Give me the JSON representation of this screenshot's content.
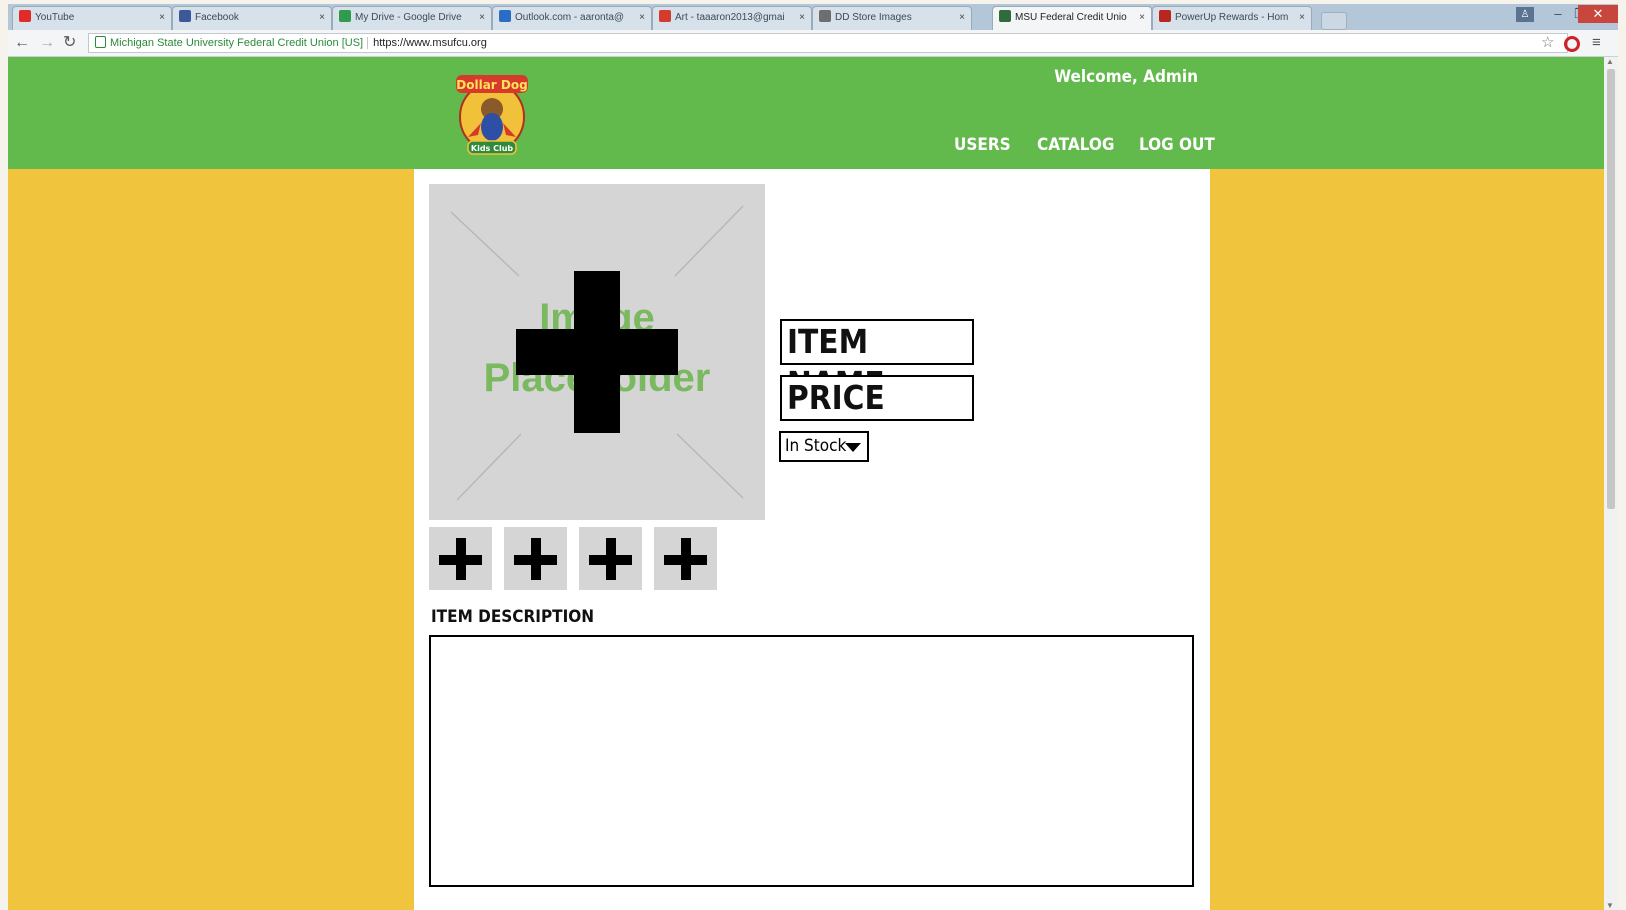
{
  "browser": {
    "tabs": [
      {
        "title": "YouTube",
        "favicon": "youtube-favicon",
        "color": "#e32a2a"
      },
      {
        "title": "Facebook",
        "favicon": "facebook-favicon",
        "color": "#3b5998"
      },
      {
        "title": "My Drive - Google Drive",
        "favicon": "google-drive-favicon",
        "color": "#2e9b4f"
      },
      {
        "title": "Outlook.com - aaronta@",
        "favicon": "outlook-favicon",
        "color": "#2b6cc4"
      },
      {
        "title": "Art - taaaron2013@gmai",
        "favicon": "gmail-favicon",
        "color": "#d33b2c"
      },
      {
        "title": "DD Store Images",
        "favicon": "folder-favicon",
        "color": "#6e6e6e"
      },
      {
        "title": "MSU Federal Credit Unio",
        "favicon": "msu-favicon",
        "color": "#2f6b3b",
        "active": true
      },
      {
        "title": "PowerUp Rewards - Hom",
        "favicon": "gamestop-favicon",
        "color": "#b8261f"
      }
    ],
    "tab_close_glyph": "×",
    "address": {
      "site_name": "Michigan State University Federal Credit Union [US]",
      "url": "https://www.msufcu.org"
    }
  },
  "header": {
    "welcome": "Welcome, Admin",
    "nav": [
      {
        "label": "USERS"
      },
      {
        "label": "CATALOG"
      },
      {
        "label": "LOG OUT"
      }
    ],
    "logo_text_top": "Dollar Dog",
    "logo_text_bottom": "Kids Club"
  },
  "form": {
    "image_placeholder": {
      "line1": "Image",
      "line2": "Placeholder"
    },
    "item_name": "ITEM NAME",
    "price": "PRICE",
    "stock_selected": "In Stock",
    "description_label": "ITEM DESCRIPTION",
    "description_value": ""
  },
  "colors": {
    "header_green": "#62b94c",
    "background_yellow": "#f1c43e",
    "placeholder_gray": "#d5d5d5",
    "placeholder_text_green": "#7ab960"
  }
}
